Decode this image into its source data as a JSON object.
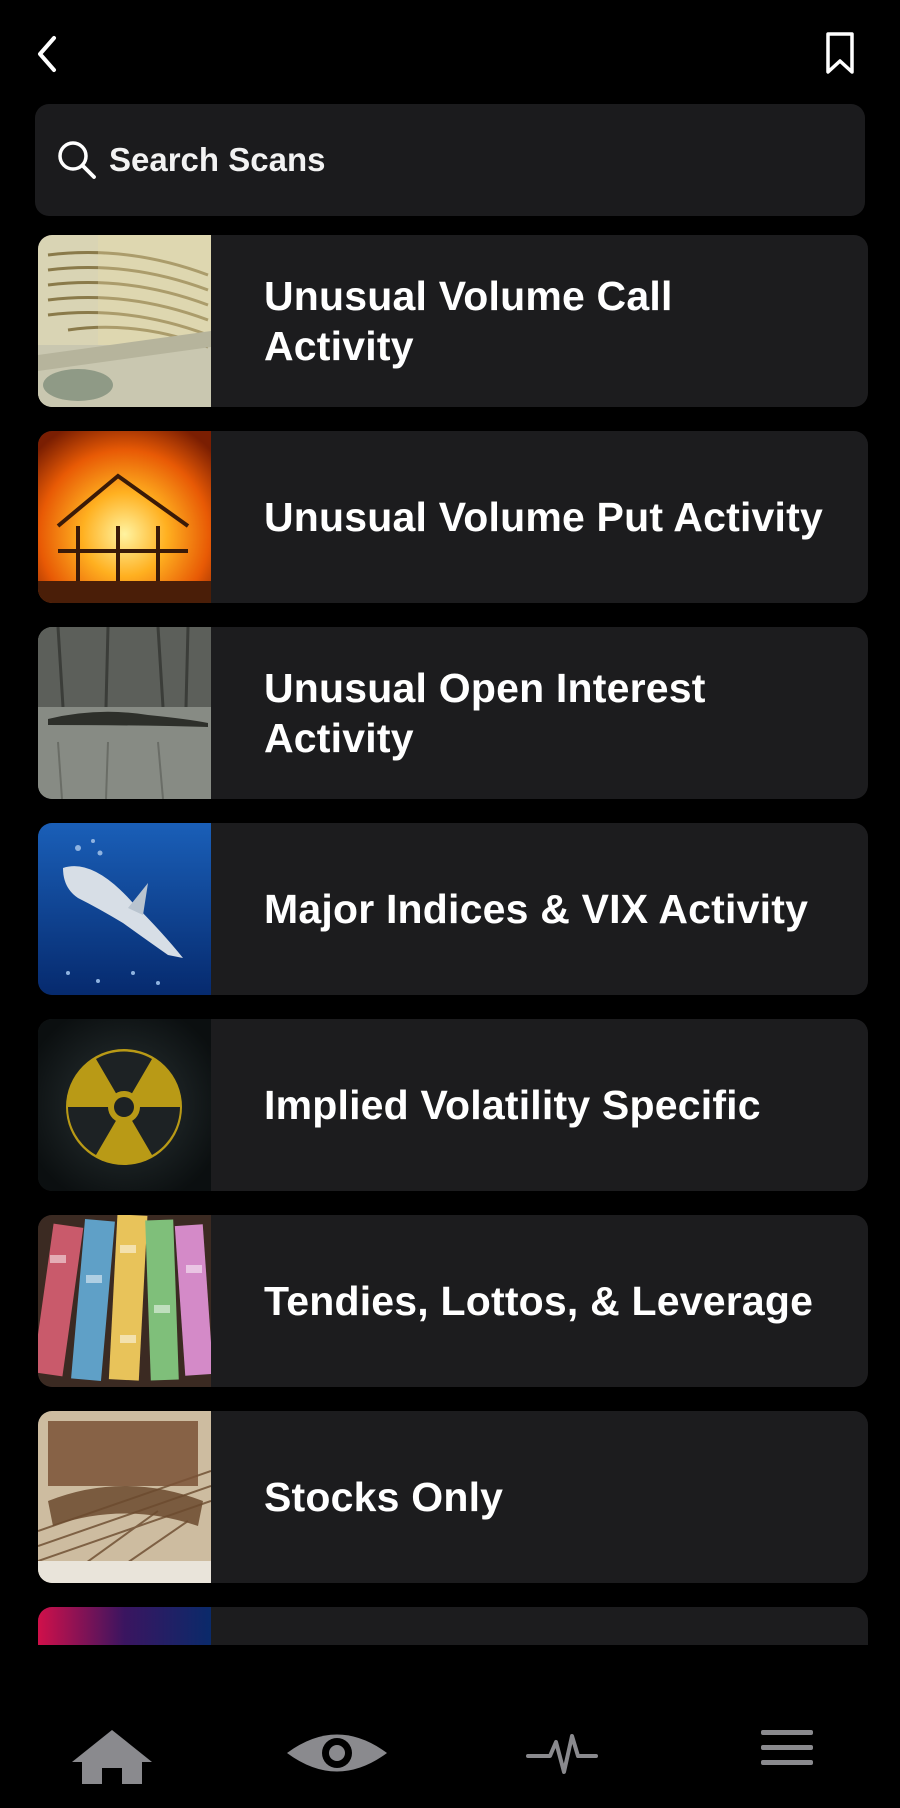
{
  "header": {
    "back_icon": "chevron-left-icon",
    "bookmark_icon": "bookmark-icon"
  },
  "search": {
    "label": "Search Scans",
    "icon": "search-icon"
  },
  "scans": [
    {
      "title": "Unusual Volume Call Activity",
      "image": "cash-stack-photo"
    },
    {
      "title": "Unusual Volume Put Activity",
      "image": "burning-house-photo"
    },
    {
      "title": "Unusual Open Interest Activity",
      "image": "alligator-photo"
    },
    {
      "title": "Major Indices & VIX Activity",
      "image": "shark-photo"
    },
    {
      "title": "Implied Volatility Specific",
      "image": "radiation-symbol-photo"
    },
    {
      "title": "Tendies, Lottos, & Leverage",
      "image": "lottery-tickets-photo"
    },
    {
      "title": "Stocks Only",
      "image": "stock-certificate-photo"
    },
    {
      "title": "",
      "image": "neon-chart-photo"
    }
  ],
  "tabbar": {
    "items": [
      {
        "icon": "home-icon"
      },
      {
        "icon": "eye-icon"
      },
      {
        "icon": "pulse-icon"
      },
      {
        "icon": "menu-icon"
      }
    ]
  },
  "colors": {
    "background": "#000000",
    "card": "#1c1c1e",
    "search_bg": "#1b1b1d",
    "icon_inactive": "#8a8a8e",
    "text": "#ffffff"
  }
}
